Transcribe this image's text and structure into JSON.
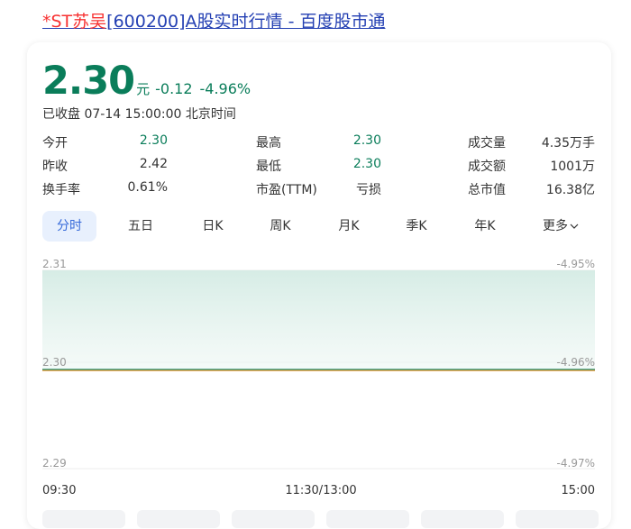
{
  "title": {
    "highlight": "*ST苏吴",
    "rest": "[600200]A股实时行情 - 百度股市通"
  },
  "quote": {
    "price": "2.30",
    "unit": "元",
    "change": "-0.12",
    "change_pct": "-4.96%",
    "status": "已收盘 07-14 15:00:00 北京时间"
  },
  "stats": [
    {
      "label": "今开",
      "value": "2.30",
      "color": "#0a7d5a"
    },
    {
      "label": "最高",
      "value": "2.30",
      "color": "#0a7d5a"
    },
    {
      "label": "成交量",
      "value": "4.35万手",
      "color": "#333333"
    },
    {
      "label": "昨收",
      "value": "2.42",
      "color": "#333333"
    },
    {
      "label": "最低",
      "value": "2.30",
      "color": "#0a7d5a"
    },
    {
      "label": "成交额",
      "value": "1001万",
      "color": "#333333"
    },
    {
      "label": "换手率",
      "value": "0.61%",
      "color": "#333333"
    },
    {
      "label": "市盈(TTM)",
      "value": "亏损",
      "color": "#333333"
    },
    {
      "label": "总市值",
      "value": "16.38亿",
      "color": "#333333"
    }
  ],
  "tabs": [
    "分时",
    "五日",
    "日K",
    "周K",
    "月K",
    "季K",
    "年K",
    "更多"
  ],
  "active_tab": "分时",
  "chart_data": {
    "type": "line",
    "y_labels_left": [
      "2.31",
      "2.30",
      "2.29"
    ],
    "y_labels_right": [
      "-4.95%",
      "-4.96%",
      "-4.97%"
    ],
    "x_labels": [
      "09:30",
      "11:30/13:00",
      "15:00"
    ],
    "ylim": [
      2.29,
      2.31
    ],
    "series": [
      {
        "values": [
          2.3,
          2.3,
          2.3,
          2.3,
          2.3,
          2.3,
          2.3,
          2.3,
          2.3,
          2.3,
          2.3
        ],
        "color": "#0a7d5a"
      },
      {
        "values": [
          2.3,
          2.3,
          2.3,
          2.3,
          2.3,
          2.3,
          2.3,
          2.3,
          2.3,
          2.3,
          2.3
        ],
        "color": "#e8a24a"
      }
    ],
    "fill_color": "#d9efe8"
  }
}
